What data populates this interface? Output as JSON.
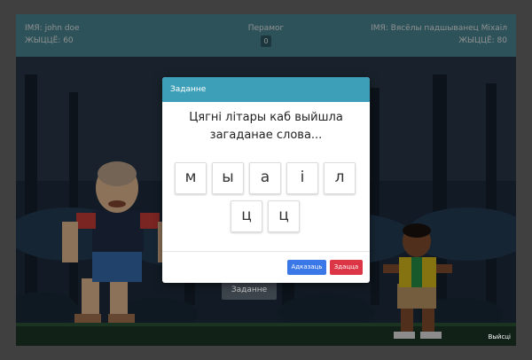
{
  "hud": {
    "player1_name": "ІМЯ: john doe",
    "player1_life": "ЖЫЦЦЁ: 60",
    "wins_label": "Перамог",
    "wins_count": "0",
    "player2_name": "ІМЯ: Вясёлы падшыванец Міхаіл",
    "player2_life": "ЖЫЦЦЁ: 80"
  },
  "scene": {
    "task_button_label": "Заданне",
    "exit_label": "Выйсці"
  },
  "modal": {
    "title": "Заданне",
    "question": "Цягні літары каб выйшла\nзагаданае слова...",
    "letters": [
      "м",
      "ы",
      "а",
      "і",
      "л",
      "ц",
      "ц"
    ],
    "answer_label": "Адказаць",
    "giveup_label": "Здацца"
  },
  "colors": {
    "hud_bg": "#4f8e9a",
    "modal_header": "#3ea0b8",
    "answer_button": "#3b78e7",
    "giveup_button": "#dc3545"
  }
}
